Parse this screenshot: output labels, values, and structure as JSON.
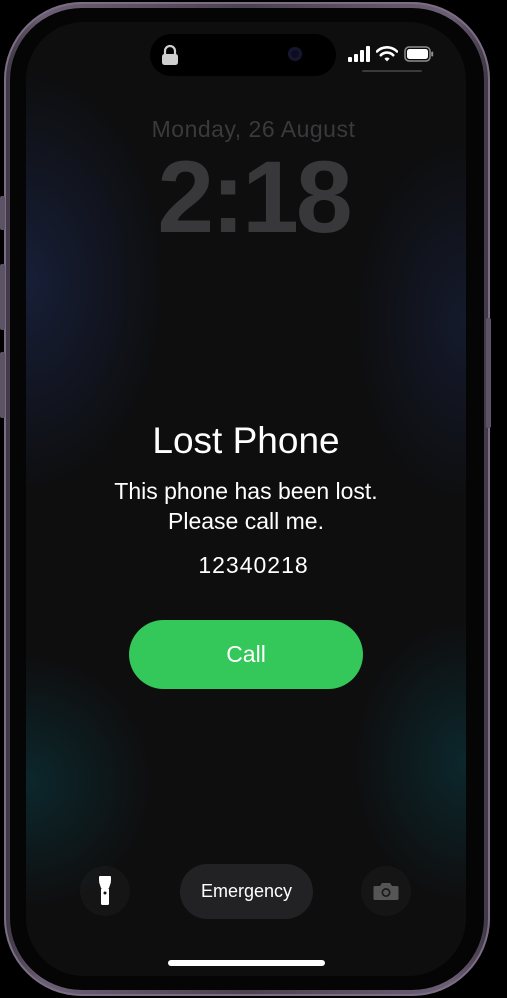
{
  "lock_screen": {
    "date": "Monday, 26 August",
    "time": "2:18"
  },
  "lost_mode": {
    "title": "Lost  Phone",
    "message": "This  phone has been lost.\nPlease call me.",
    "phone_number": "12340218",
    "call_label": "Call"
  },
  "bottom_bar": {
    "emergency_label": "Emergency"
  },
  "colors": {
    "call_green": "#34c759",
    "frame": "#6b5f74"
  },
  "icons": {
    "lock": "lock-icon",
    "signal": "signal-icon",
    "wifi": "wifi-icon",
    "battery": "battery-icon",
    "flashlight": "flashlight-icon",
    "camera": "camera-icon"
  }
}
